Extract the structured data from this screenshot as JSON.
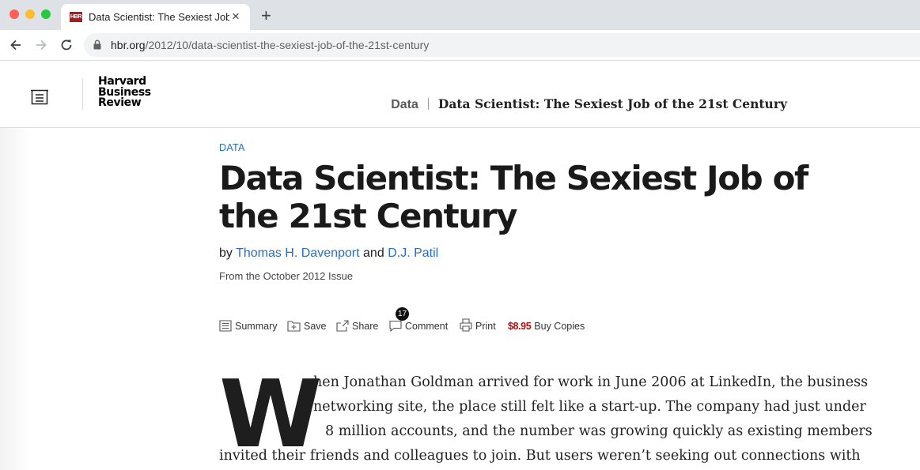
{
  "browser": {
    "tab_title": "Data Scientist: The Sexiest Job of the 21st Century",
    "favicon_text": "HBR",
    "url_host": "hbr.org",
    "url_path": "/2012/10/data-scientist-the-sexiest-job-of-the-21st-century"
  },
  "header": {
    "logo_lines": [
      "Harvard",
      "Business",
      "Review"
    ],
    "breadcrumb_section": "Data",
    "breadcrumb_title": "Data Scientist: The Sexiest Job of the 21st Century"
  },
  "article": {
    "section": "DATA",
    "headline": "Data Scientist: The Sexiest Job of the 21st Century",
    "byline_prefix": "by",
    "author1": "Thomas H. Davenport",
    "byline_and": "and",
    "author2": "D.J. Patil",
    "issue": "From the October 2012 Issue",
    "actions": {
      "summary": "Summary",
      "save": "Save",
      "share": "Share",
      "comment": "Comment",
      "comment_count": "17",
      "print": "Print",
      "price": "$8.95",
      "buy": "Buy Copies"
    },
    "dropcap": "W",
    "body_lines": [
      "hen Jonathan Goldman arrived for work in June 2006 at LinkedIn, the business",
      "networking site, the place still felt like a start-up. The company had just under",
      "8 million accounts, and the number was growing quickly as existing members",
      "invited their friends and colleagues to join. But users weren’t seeking out connections with"
    ]
  },
  "colors": {
    "accent_link": "#2a6ebb",
    "price_red": "#b50f0f",
    "hbr_red": "#a41e22"
  }
}
